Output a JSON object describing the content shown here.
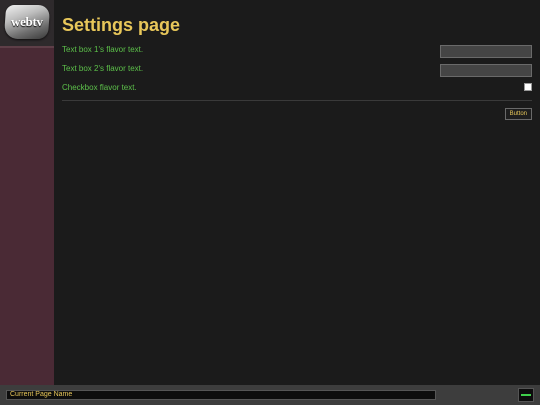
{
  "logo": {
    "text": "webtv"
  },
  "page": {
    "title": "Settings page"
  },
  "settings": {
    "textbox1_label": "Text box 1's flavor text.",
    "textbox1_value": "",
    "textbox2_label": "Text box 2's flavor text.",
    "textbox2_value": "",
    "checkbox_label": "Checkbox flavor text.",
    "checkbox_checked": false
  },
  "button": {
    "label": "Button"
  },
  "status_bar": {
    "page_name": "Current Page Name"
  },
  "colors": {
    "sidebar": "#4a2a35",
    "background": "#1b1b1b",
    "title": "#e8c75a",
    "label": "#5cc04a"
  }
}
